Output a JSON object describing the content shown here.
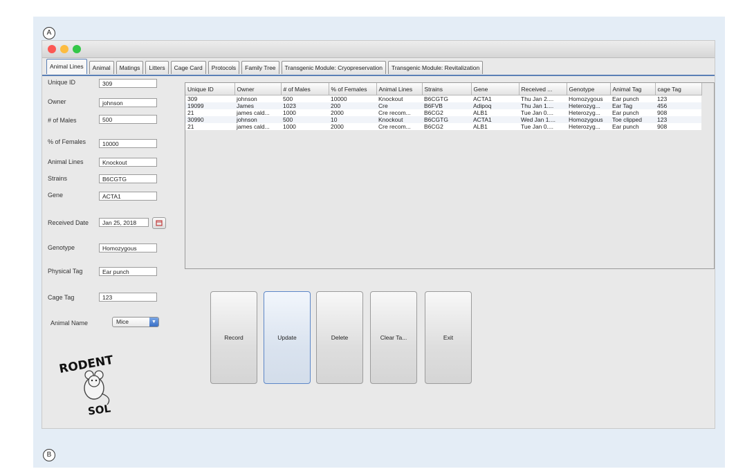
{
  "labels": {
    "a": "A",
    "b": "B"
  },
  "window": {
    "traffic_lights": [
      "#fc5753",
      "#fdbc40",
      "#33c748"
    ]
  },
  "tabs": [
    "Animal Lines",
    "Animal",
    "Matings",
    "Litters",
    "Cage Card",
    "Protocols",
    "Family Tree",
    "Transgenic Module: Cryopreservation",
    "Transgenic Module: Revitalization"
  ],
  "form": {
    "unique_id": {
      "label": "Unique ID",
      "value": "309"
    },
    "owner": {
      "label": "Owner",
      "value": "johnson"
    },
    "males": {
      "label": "# of Males",
      "value": "500"
    },
    "females": {
      "label": "% of Females",
      "value": "10000"
    },
    "animal_lines": {
      "label": "Animal Lines",
      "value": "Knockout"
    },
    "strains": {
      "label": "Strains",
      "value": "B6CGTG"
    },
    "gene": {
      "label": "Gene",
      "value": "ACTA1"
    },
    "received": {
      "label": "Received Date",
      "value": "Jan 25, 2018"
    },
    "genotype": {
      "label": "Genotype",
      "value": "Homozygous"
    },
    "physical_tag": {
      "label": "Physical Tag",
      "value": "Ear punch"
    },
    "cage_tag": {
      "label": "Cage Tag",
      "value": "123"
    },
    "animal_name": {
      "label": "Animal Name",
      "value": "Mice"
    }
  },
  "table": {
    "columns": [
      "Unique ID",
      "Owner",
      "# of Males",
      "% of Females",
      "Animal Lines",
      "Strains",
      "Gene",
      "Received ...",
      "Genotype",
      "Animal Tag",
      "cage Tag"
    ],
    "rows": [
      [
        "309",
        "johnson",
        "500",
        "10000",
        "Knockout",
        "B6CGTG",
        "ACTA1",
        "Thu Jan 2....",
        "Homozygous",
        "Ear punch",
        "123"
      ],
      [
        "19099",
        "James",
        "1023",
        "200",
        "Cre",
        "B6FVB",
        "Adipoq",
        "Thu Jan 1....",
        "Heterozyg...",
        "Ear Tag",
        "456"
      ],
      [
        "21",
        "james cald...",
        "1000",
        "2000",
        "Cre recom...",
        "B6CG2",
        "ALB1",
        "Tue Jan 0....",
        "Heterozyg...",
        "Ear punch",
        "908"
      ],
      [
        "30990",
        "johnson",
        "500",
        "10",
        "Knockout",
        "B6CGTG",
        "ACTA1",
        "Wed Jan 1....",
        "Homozygous",
        "Toe clipped",
        "123"
      ],
      [
        "21",
        "james cald...",
        "1000",
        "2000",
        "Cre recom...",
        "B6CG2",
        "ALB1",
        "Tue Jan 0....",
        "Heterozyg...",
        "Ear punch",
        "908"
      ]
    ]
  },
  "buttons": [
    "Record",
    "Update",
    "Delete",
    "Clear Ta...",
    "Exit"
  ],
  "logo": {
    "top": "RODENT",
    "bottom": "SOL"
  }
}
